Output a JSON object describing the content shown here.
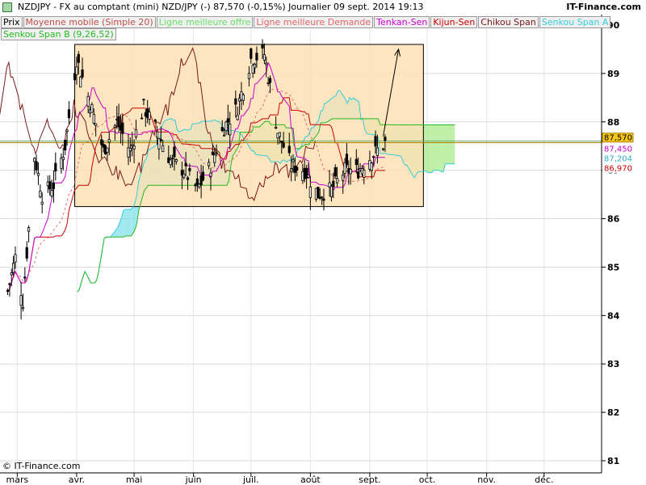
{
  "header": {
    "title": "NZDJPY - FX au comptant (mini) NZD/JPY (-)   87,570 (-0,15%)   Journalier  09 sept. 2014 19:13",
    "brand": "IT-Finance.com"
  },
  "legend": [
    {
      "label": "Prix",
      "color": "#000000"
    },
    {
      "label": "Moyenne mobile (Simple 20)",
      "color": "#c0504d"
    },
    {
      "label": "Ligne meilleure offre",
      "color": "#66dd66"
    },
    {
      "label": "Ligne meilleure Demande",
      "color": "#e06666"
    },
    {
      "label": "Tenkan-Sen",
      "color": "#cc00cc"
    },
    {
      "label": "Kijun-Sen",
      "color": "#cc0000"
    },
    {
      "label": "Chikou Span",
      "color": "#7b1a1a"
    },
    {
      "label": "Senkou Span A",
      "color": "#33ccdd"
    },
    {
      "label": "Senkou Span B (9,26,52)",
      "color": "#22bb22"
    }
  ],
  "copyright": "© IT-Finance.com",
  "chart_data": {
    "type": "candlestick",
    "y_ticks": [
      "81",
      "82",
      "83",
      "84",
      "85",
      "86",
      "87",
      "88",
      "89",
      "90"
    ],
    "x_ticks": [
      "mars",
      "avr.",
      "mai",
      "juin",
      "juil.",
      "août",
      "sept.",
      "oct.",
      "nov.",
      "déc."
    ],
    "ylim": [
      80.9,
      90.3
    ],
    "price_labels": [
      {
        "text": "87,570",
        "value": 87.57,
        "bg": "#f5c518",
        "fg": "#000000"
      },
      {
        "text": "87,450",
        "value": 87.45,
        "bg": "#ffffff",
        "fg": "#cc00cc"
      },
      {
        "text": "87,204",
        "value": 87.204,
        "bg": "#ffffff",
        "fg": "#33aacc"
      },
      {
        "text": "86,970",
        "value": 86.97,
        "bg": "#ffffff",
        "fg": "#cc0000"
      }
    ],
    "range_box": {
      "start": "2014-03-31",
      "end": "2014-09-29",
      "low": 86.25,
      "high": 89.6
    },
    "arrow": {
      "from": [
        "2014-09-08",
        87.7
      ],
      "to": [
        "2014-09-16",
        89.5
      ]
    },
    "closes": [
      {
        "date": "2014-02-24",
        "close": 84.5
      },
      {
        "date": "2014-02-28",
        "close": 85.2
      },
      {
        "date": "2014-03-04",
        "close": 84.3
      },
      {
        "date": "2014-03-10",
        "close": 87.3
      },
      {
        "date": "2014-03-14",
        "close": 86.5
      },
      {
        "date": "2014-03-20",
        "close": 86.7
      },
      {
        "date": "2014-03-26",
        "close": 87.5
      },
      {
        "date": "2014-04-01",
        "close": 89.3
      },
      {
        "date": "2014-04-08",
        "close": 88.4
      },
      {
        "date": "2014-04-15",
        "close": 87.4
      },
      {
        "date": "2014-04-22",
        "close": 88.0
      },
      {
        "date": "2014-04-29",
        "close": 87.4
      },
      {
        "date": "2014-05-06",
        "close": 88.3
      },
      {
        "date": "2014-05-13",
        "close": 87.8
      },
      {
        "date": "2014-05-20",
        "close": 87.2
      },
      {
        "date": "2014-05-27",
        "close": 87.0
      },
      {
        "date": "2014-06-03",
        "close": 86.6
      },
      {
        "date": "2014-06-10",
        "close": 87.1
      },
      {
        "date": "2014-06-17",
        "close": 87.9
      },
      {
        "date": "2014-06-24",
        "close": 88.3
      },
      {
        "date": "2014-07-01",
        "close": 89.3
      },
      {
        "date": "2014-07-08",
        "close": 89.4
      },
      {
        "date": "2014-07-15",
        "close": 87.8
      },
      {
        "date": "2014-07-22",
        "close": 87.1
      },
      {
        "date": "2014-07-29",
        "close": 87.0
      },
      {
        "date": "2014-08-05",
        "close": 86.5
      },
      {
        "date": "2014-08-12",
        "close": 86.6
      },
      {
        "date": "2014-08-19",
        "close": 87.0
      },
      {
        "date": "2014-08-26",
        "close": 87.0
      },
      {
        "date": "2014-09-02",
        "close": 87.3
      },
      {
        "date": "2014-09-09",
        "close": 87.57
      }
    ]
  }
}
